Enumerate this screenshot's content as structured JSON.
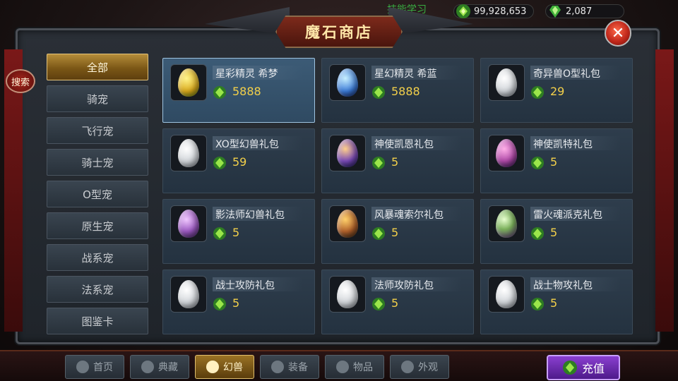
{
  "topbar": {
    "hint": "技能学习",
    "currency_green": "99,928,653",
    "currency_gem": "2,087"
  },
  "title": "魔石商店",
  "search_label": "搜索",
  "categories": [
    {
      "label": "全部",
      "active": true
    },
    {
      "label": "骑宠"
    },
    {
      "label": "飞行宠"
    },
    {
      "label": "骑士宠"
    },
    {
      "label": "O型宠"
    },
    {
      "label": "原生宠"
    },
    {
      "label": "战系宠"
    },
    {
      "label": "法系宠"
    },
    {
      "label": "图鉴卡"
    }
  ],
  "items": [
    {
      "name": "星彩精灵 希梦",
      "price": "5888",
      "egg": "golden-egg"
    },
    {
      "name": "星幻精灵 希蓝",
      "price": "5888",
      "egg": "blue-crystal-egg"
    },
    {
      "name": "奇异兽O型礼包",
      "price": "29",
      "egg": "white-egg"
    },
    {
      "name": "XO型幻兽礼包",
      "price": "59",
      "egg": "white-egg"
    },
    {
      "name": "神使凯恩礼包",
      "price": "5",
      "egg": "purple-galaxy-egg"
    },
    {
      "name": "神使凯特礼包",
      "price": "5",
      "egg": "pink-crystal-egg"
    },
    {
      "name": "影法师幻兽礼包",
      "price": "5",
      "egg": "violet-egg"
    },
    {
      "name": "风暴魂索尔礼包",
      "price": "5",
      "egg": "fire-egg"
    },
    {
      "name": "雷火魂派克礼包",
      "price": "5",
      "egg": "green-purple-egg"
    },
    {
      "name": "战士攻防礼包",
      "price": "5",
      "egg": "white-egg"
    },
    {
      "name": "法师攻防礼包",
      "price": "5",
      "egg": "white-egg"
    },
    {
      "name": "战士物攻礼包",
      "price": "5",
      "egg": "white-egg"
    }
  ],
  "nav": [
    {
      "label": "首页",
      "icon": "home-icon"
    },
    {
      "label": "典藏",
      "icon": "collection-icon"
    },
    {
      "label": "幻兽",
      "icon": "beast-icon",
      "active": true
    },
    {
      "label": "装备",
      "icon": "equipment-icon"
    },
    {
      "label": "物品",
      "icon": "item-icon"
    },
    {
      "label": "外观",
      "icon": "appearance-icon"
    }
  ],
  "recharge_label": "充值",
  "colors": {
    "accent_gold": "#f3d04a",
    "active_tab": "#9a7224",
    "recharge": "#8a3fd0",
    "close": "#c0281b"
  }
}
